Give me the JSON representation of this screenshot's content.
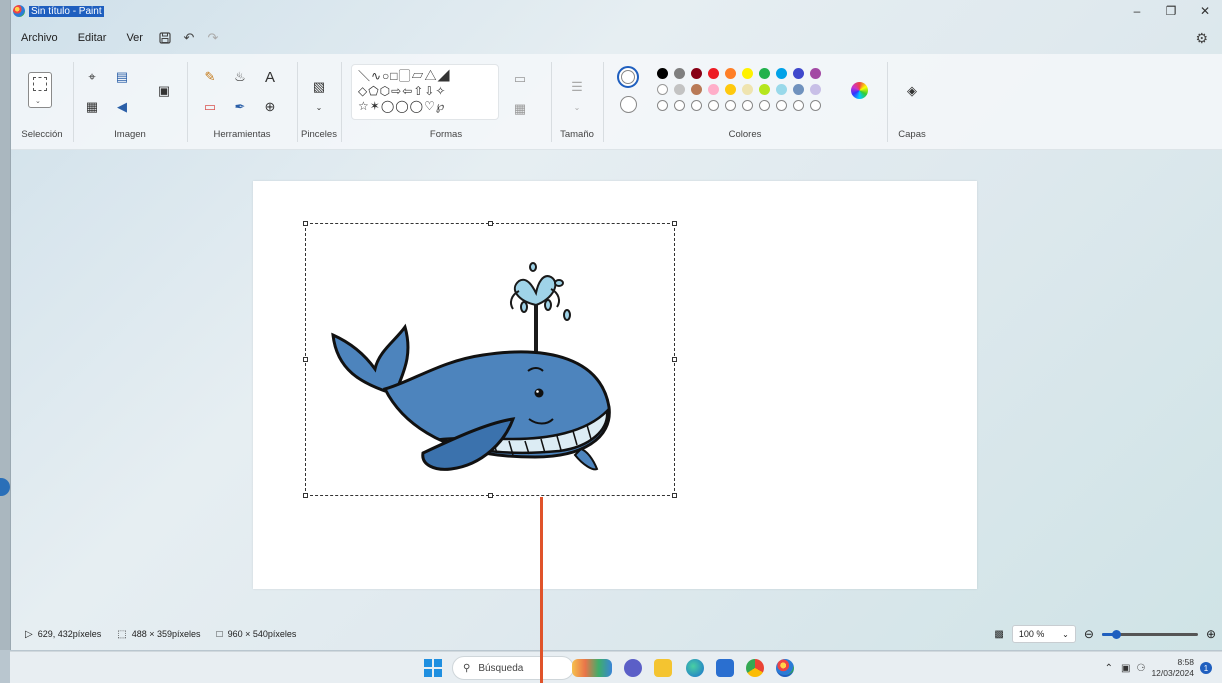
{
  "window": {
    "title": "Sin título - Paint"
  },
  "menu": {
    "file": "Archivo",
    "edit": "Editar",
    "view": "Ver"
  },
  "ribbon": {
    "groups": {
      "selection": "Selección",
      "image": "Imagen",
      "tools": "Herramientas",
      "brushes": "Pinceles",
      "shapes": "Formas",
      "size": "Tamaño",
      "colors": "Colores",
      "layers": "Capas"
    },
    "text_tool": "A",
    "palette_row1": [
      "#000000",
      "#7f7f7f",
      "#880015",
      "#ed1c24",
      "#ff7f27",
      "#fff200",
      "#22b14c",
      "#00a2e8",
      "#3f48cc",
      "#a349a4"
    ],
    "palette_row2": [
      "#ffffff",
      "#c3c3c3",
      "#b97a57",
      "#ffaec9",
      "#ffc90e",
      "#efe4b0",
      "#b5e61d",
      "#99d9ea",
      "#7092be",
      "#c8bfe7"
    ]
  },
  "status": {
    "cursor": "629, 432píxeles",
    "selection_size": "488 × 359píxeles",
    "canvas_size": "960 × 540píxeles",
    "zoom": "100 %",
    "zoom_level": 0.15
  },
  "taskbar": {
    "search_placeholder": "Búsqueda",
    "time": "8:58",
    "date": "12/03/2024",
    "notifications": "1"
  }
}
